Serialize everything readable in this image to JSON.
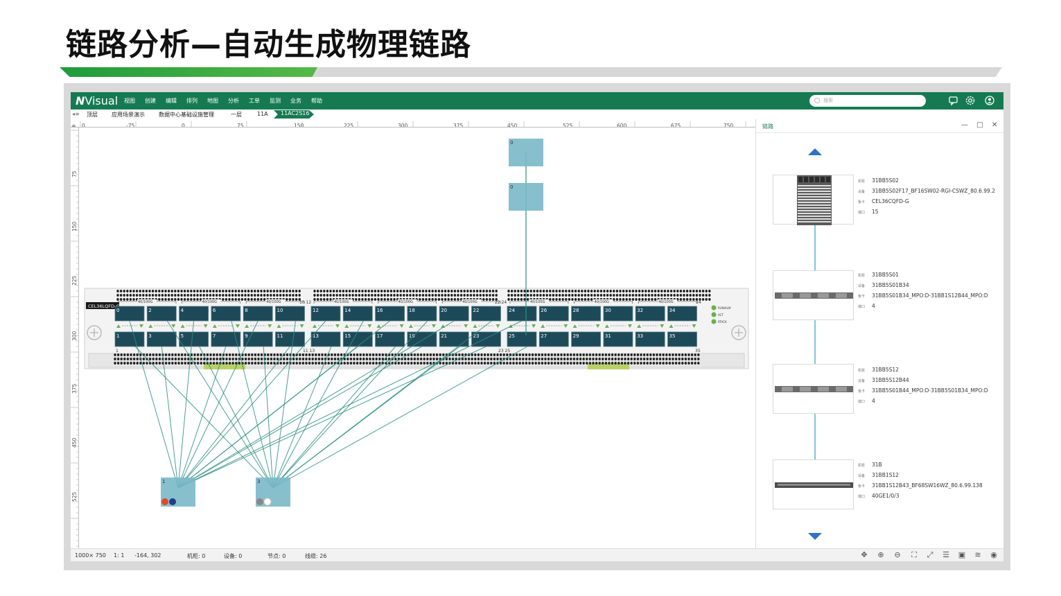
{
  "slide": {
    "title": "链路分析—自动生成物理链路"
  },
  "app": {
    "logo_n": "N",
    "logo_rest": "Visual",
    "menu": [
      "视图",
      "创建",
      "编辑",
      "排列",
      "地图",
      "分析",
      "工单",
      "监测",
      "业务",
      "帮助"
    ],
    "search_placeholder": "搜索",
    "icons": [
      "chat-icon",
      "settings-icon",
      "user-icon"
    ]
  },
  "breadcrumb": {
    "items": [
      "顶层",
      "应用场景演示",
      "数据中心基础设施管理",
      "一层",
      "11A"
    ],
    "active": "11AC2S16"
  },
  "ruler": {
    "h_labels": [
      "0",
      "-75",
      "0",
      "75",
      "150",
      "225",
      "300",
      "375",
      "450",
      "525",
      "600",
      "675",
      "750"
    ],
    "v_labels": [
      "75",
      "150",
      "225",
      "300",
      "375",
      "450",
      "525"
    ]
  },
  "canvas": {
    "card_label": "CEL36LQFD-G",
    "speed_label": "40/100G",
    "top_row_ports": [
      "0",
      "2",
      "4",
      "6",
      "8",
      "10",
      "12",
      "14",
      "16",
      "18",
      "20",
      "22",
      "24",
      "26",
      "28",
      "30",
      "32",
      "34"
    ],
    "bottom_row_ports": [
      "1",
      "3",
      "5",
      "7",
      "9",
      "11",
      "13",
      "15",
      "17",
      "19",
      "21",
      "23",
      "25",
      "27",
      "29",
      "31",
      "33",
      "35"
    ],
    "group_end_labels": [
      "10 12",
      "22 24",
      "34"
    ],
    "group_start_labels": [
      "1",
      "11 13",
      "23 25",
      "35"
    ],
    "leds": [
      "RUN/ALM",
      "ACT",
      "RTACK"
    ],
    "floating_nodes": [
      {
        "label": "0"
      },
      {
        "label": "0"
      },
      {
        "label": "1"
      },
      {
        "label": "3"
      }
    ]
  },
  "panel": {
    "title": "链路",
    "buttons": [
      "—",
      "□",
      "✕"
    ],
    "field_labels": [
      "机柜",
      "设备",
      "板卡",
      "端口"
    ],
    "nodes": [
      {
        "cabinet": "31BB5S02",
        "device": "31BB5S02F17_BF16SW02-RGI-CSWZ_80.6.99.2",
        "card": "CEL36CQFD-G",
        "port": "15"
      },
      {
        "cabinet": "31BB5S01",
        "device": "31BB5S01B34",
        "card": "31BB5S01B34_MPO:D-31BB1S12B44_MPO:D",
        "port": "4"
      },
      {
        "cabinet": "31BB5S12",
        "device": "31BB5S12B44",
        "card": "31BB5S01B44_MPO:D-31BB5S01B34_MPO:D",
        "port": "4"
      },
      {
        "cabinet": "31B",
        "device": "31BB1S12",
        "card": "31BB1S12B43_BF68SW16WZ_80.6.99.138",
        "port": "40GE1/0/3"
      }
    ]
  },
  "status": {
    "size": "1000× 750",
    "scale": "1: 1",
    "coords": "-164, 302",
    "cabinets": "机柜: 0",
    "devices": "设备: 0",
    "nodes": "节点: 0",
    "links": "线缆: 26"
  },
  "colors": {
    "brand": "#157a52",
    "port": "#1d4a59",
    "link": "#2a8f80",
    "node": "#7ab8c8"
  }
}
